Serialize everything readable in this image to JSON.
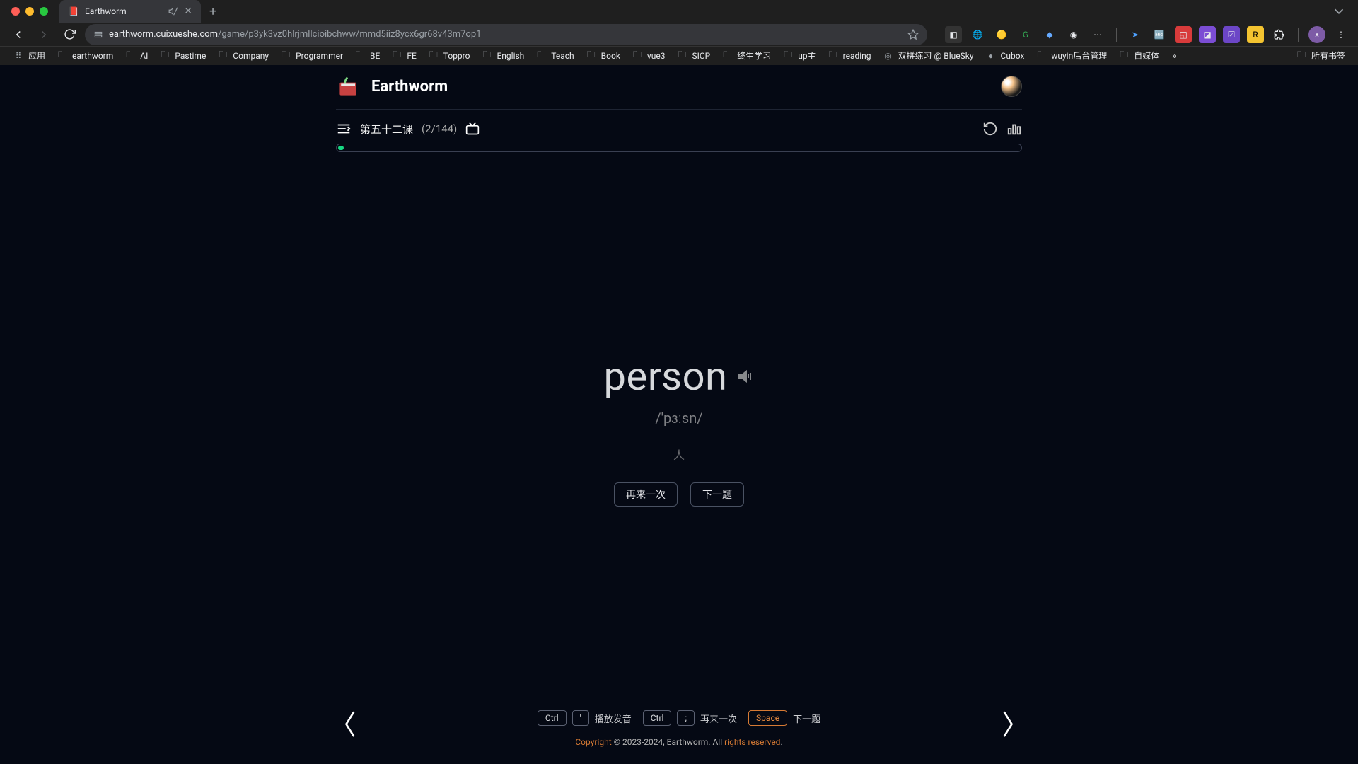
{
  "browser": {
    "tab_title": "Earthworm",
    "url_host": "earthworm.cuixueshe.com",
    "url_path": "/game/p3yk3vz0hlrjmllcioibchww/mmd5iiz8ycx6gr68v43m7op1",
    "bookmarks": [
      "应用",
      "earthworm",
      "AI",
      "Pastime",
      "Company",
      "Programmer",
      "BE",
      "FE",
      "Toppro",
      "English",
      "Teach",
      "Book",
      "vue3",
      "SICP",
      "终生学习",
      "up主",
      "reading",
      "双拼练习 @ BlueSky",
      "Cubox",
      "wuyin后台管理",
      "自媒体"
    ],
    "bookmarks_right": "所有书签"
  },
  "header": {
    "brand": "Earthworm"
  },
  "lesson": {
    "title": "第五十二课",
    "progress": "(2/144)"
  },
  "card": {
    "word": "person",
    "phonetic": "/'pɜːsn/",
    "translation": "人",
    "again_btn": "再来一次",
    "next_btn": "下一题"
  },
  "shortcuts": {
    "ctrl": "Ctrl",
    "quote": "'",
    "play_label": "播放发音",
    "semicolon": ";",
    "again_label": "再来一次",
    "space": "Space",
    "next_label": "下一题"
  },
  "footer": {
    "copyright": "Copyright",
    "mid": " © 2023-2024, Earthworm. All ",
    "rights": "rights reserved",
    "dot": "."
  }
}
